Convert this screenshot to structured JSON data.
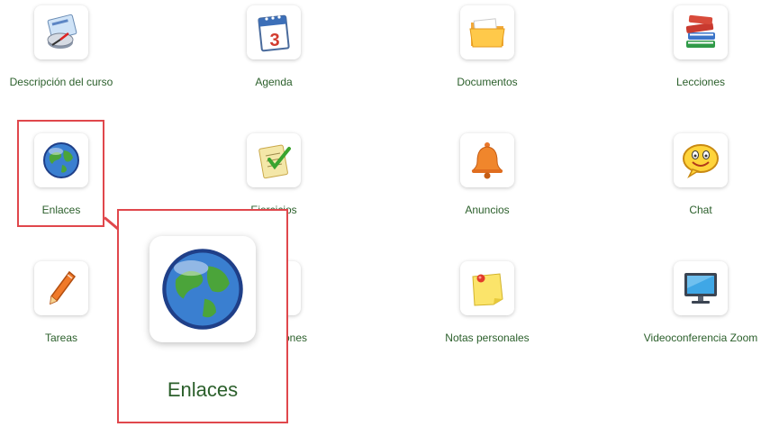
{
  "tools": [
    {
      "label": "Descripción del curso",
      "icon": "course-description-icon"
    },
    {
      "label": "Agenda",
      "icon": "calendar-icon",
      "calendar_day": "3"
    },
    {
      "label": "Documentos",
      "icon": "folder-icon"
    },
    {
      "label": "Lecciones",
      "icon": "books-icon"
    },
    {
      "label": "Enlaces",
      "icon": "globe-icon"
    },
    {
      "label": "Ejercicios",
      "icon": "checklist-icon"
    },
    {
      "label": "Anuncios",
      "icon": "bell-icon"
    },
    {
      "label": "Chat",
      "icon": "chat-smiley-icon"
    },
    {
      "label": "Tareas",
      "icon": "pen-icon"
    },
    {
      "label": "Calificaciones",
      "icon": "calculator-icon"
    },
    {
      "label": "Notas personales",
      "icon": "sticky-note-icon"
    },
    {
      "label": "Videoconferencia Zoom",
      "icon": "monitor-icon"
    }
  ],
  "zoom_callout": {
    "label": "Enlaces",
    "icon": "globe-icon"
  },
  "colors": {
    "label": "#2b5f2b",
    "highlight": "#e0474c"
  }
}
